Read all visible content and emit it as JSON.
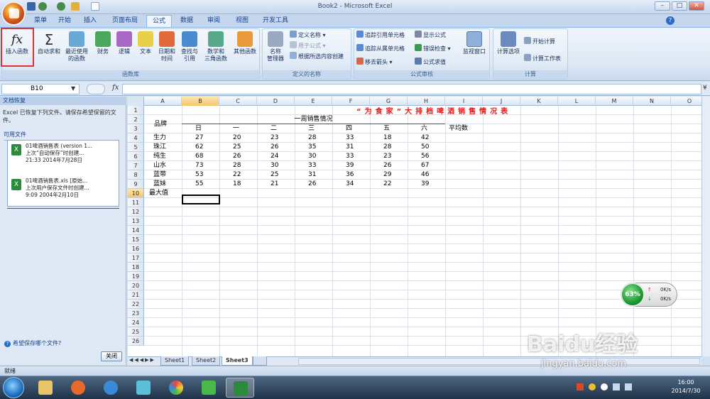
{
  "window": {
    "title": "Book2 - Microsoft Excel",
    "minimize": "–",
    "restore": "□",
    "close": "✕"
  },
  "tabs": [
    {
      "label": "菜单"
    },
    {
      "label": "开始"
    },
    {
      "label": "插入"
    },
    {
      "label": "页面布局"
    },
    {
      "label": "公式",
      "active": true
    },
    {
      "label": "数据"
    },
    {
      "label": "审阅"
    },
    {
      "label": "视图"
    },
    {
      "label": "开发工具"
    }
  ],
  "ribbon": {
    "function_library": {
      "label": "函数库",
      "insert_function": "插入函数",
      "autosum": "自动求和",
      "recent": [
        "最近使用",
        "的函数"
      ],
      "financial": "财务",
      "logical": "逻辑",
      "text": "文本",
      "datetime": [
        "日期和",
        "时间"
      ],
      "lookup": [
        "查找与",
        "引用"
      ],
      "math": [
        "数学和",
        "三角函数"
      ],
      "more": "其他函数"
    },
    "defined_names": {
      "label": "定义的名称",
      "name_manager": [
        "名称",
        "管理器"
      ],
      "define_name": "定义名称",
      "use_in_formula": "用于公式",
      "create_from_selection": "根据所选内容创建"
    },
    "formula_auditing": {
      "label": "公式审核",
      "trace_precedents": "追踪引用单元格",
      "trace_dependents": "追踪从属单元格",
      "remove_arrows": "移去箭头",
      "show_formulas": "显示公式",
      "error_checking": "错误检查",
      "evaluate_formula": "公式求值",
      "watch_window": "监视窗口"
    },
    "calculation": {
      "label": "计算",
      "options": "计算选项",
      "calc_now": "开始计算",
      "calc_sheet": "计算工作表"
    }
  },
  "formula_bar": {
    "name_box": "B10",
    "fx": "fx",
    "value": ""
  },
  "recovery_pane": {
    "title": "文档恢复",
    "message": "Excel 已恢复下列文件。请保存希望保留的文件。",
    "available": "可用文件",
    "files": [
      {
        "name": "01啤酒销售表 (version 1...",
        "desc": "上次“自动保存”时创建...",
        "time": "21:33 2014年7月28日"
      },
      {
        "name": "01啤酒销售表.xls [原始...",
        "desc": "上次用户保存文件时创建...",
        "time": "9:09 2004年2月10日"
      }
    ],
    "help": "希望保存哪个文件?",
    "close": "关闭"
  },
  "grid": {
    "columns": [
      "A",
      "B",
      "C",
      "D",
      "E",
      "F",
      "G",
      "H",
      "I",
      "J",
      "K",
      "L",
      "M",
      "N",
      "O"
    ],
    "rows": [
      "1",
      "2",
      "3",
      "4",
      "5",
      "6",
      "7",
      "8",
      "9",
      "10",
      "11",
      "12",
      "13",
      "14",
      "15",
      "16",
      "17",
      "18",
      "19",
      "20",
      "21",
      "22",
      "23",
      "24",
      "25",
      "26"
    ],
    "sheet_title": "“为食家”大排档啤酒销售情况表",
    "week_title": "一周销售情况",
    "brand_header": "品牌",
    "avg_header": "平均数",
    "max_label": "最大值",
    "days": [
      "日",
      "一",
      "二",
      "三",
      "四",
      "五",
      "六"
    ],
    "data": [
      {
        "brand": "生力",
        "values": [
          "27",
          "20",
          "23",
          "28",
          "33",
          "18",
          "42"
        ]
      },
      {
        "brand": "珠江",
        "values": [
          "62",
          "25",
          "26",
          "35",
          "31",
          "28",
          "50"
        ]
      },
      {
        "brand": "纯生",
        "values": [
          "68",
          "26",
          "24",
          "30",
          "33",
          "23",
          "56"
        ]
      },
      {
        "brand": "山水",
        "values": [
          "73",
          "28",
          "30",
          "33",
          "39",
          "26",
          "67"
        ]
      },
      {
        "brand": "蓝带",
        "values": [
          "53",
          "22",
          "25",
          "31",
          "36",
          "29",
          "46"
        ]
      },
      {
        "brand": "蓝妹",
        "values": [
          "55",
          "18",
          "21",
          "26",
          "34",
          "22",
          "39"
        ]
      }
    ]
  },
  "sheets": [
    {
      "label": "Sheet1"
    },
    {
      "label": "Sheet2"
    },
    {
      "label": "Sheet3",
      "active": true
    }
  ],
  "status": {
    "ready": "就绪"
  },
  "taskbar": {
    "time": "16:00",
    "date": "2014/7/30"
  },
  "network_widget": {
    "percent": "63%",
    "up": "0K/s",
    "down": "0K/s"
  },
  "watermark": {
    "text": "Baidu经验",
    "url": "jingyan.baidu.com"
  }
}
